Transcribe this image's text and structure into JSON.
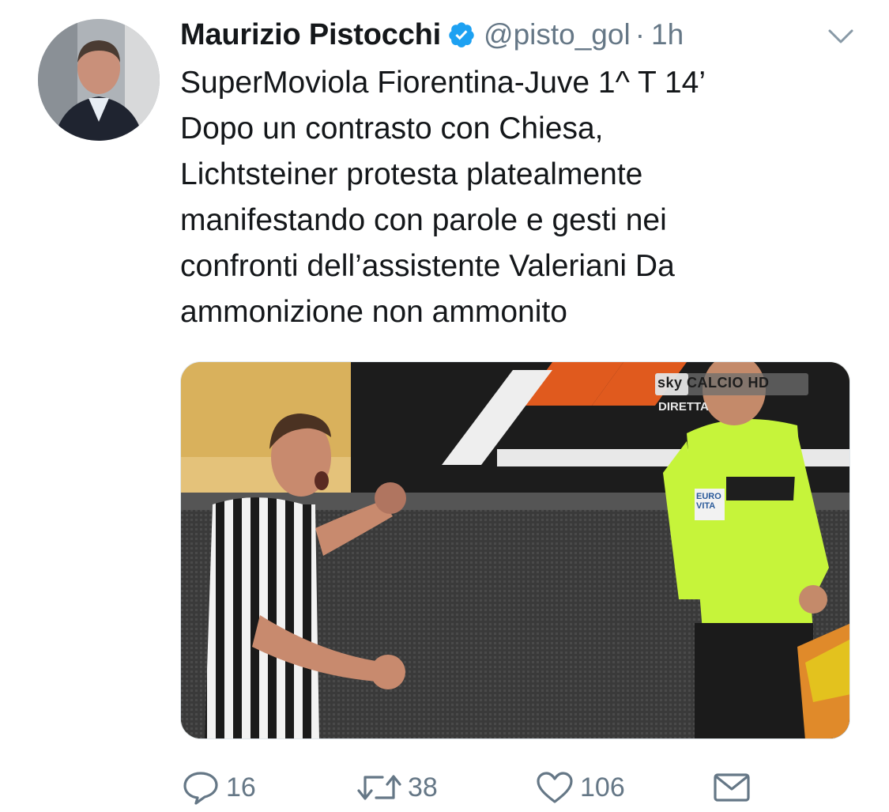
{
  "tweet": {
    "author_name": "Maurizio Pistocchi",
    "handle": "@pisto_gol",
    "separator": "·",
    "time": "1h",
    "lines": [
      "SuperMoviola Fiorentina-Juve 1^ T 14’",
      "Dopo un contrasto con Chiesa,",
      "Lichtsteiner protesta platealmente",
      "manifestando con parole e gesti nei",
      "confronti dell’assistente Valeriani Da",
      "ammonizione non ammonito"
    ]
  },
  "media": {
    "broadcast_logo": "sky CALCIO HD",
    "broadcast_status": "DIRETTA",
    "sponsor": "EURO VITA"
  },
  "actions": {
    "replies": "16",
    "retweets": "38",
    "likes": "106"
  },
  "colors": {
    "verified_blue": "#1da1f2",
    "muted_gray": "#657786",
    "text": "#14171a"
  },
  "icons": [
    "verified-badge-icon",
    "chevron-down-icon",
    "reply-icon",
    "retweet-icon",
    "like-icon",
    "direct-message-icon"
  ]
}
